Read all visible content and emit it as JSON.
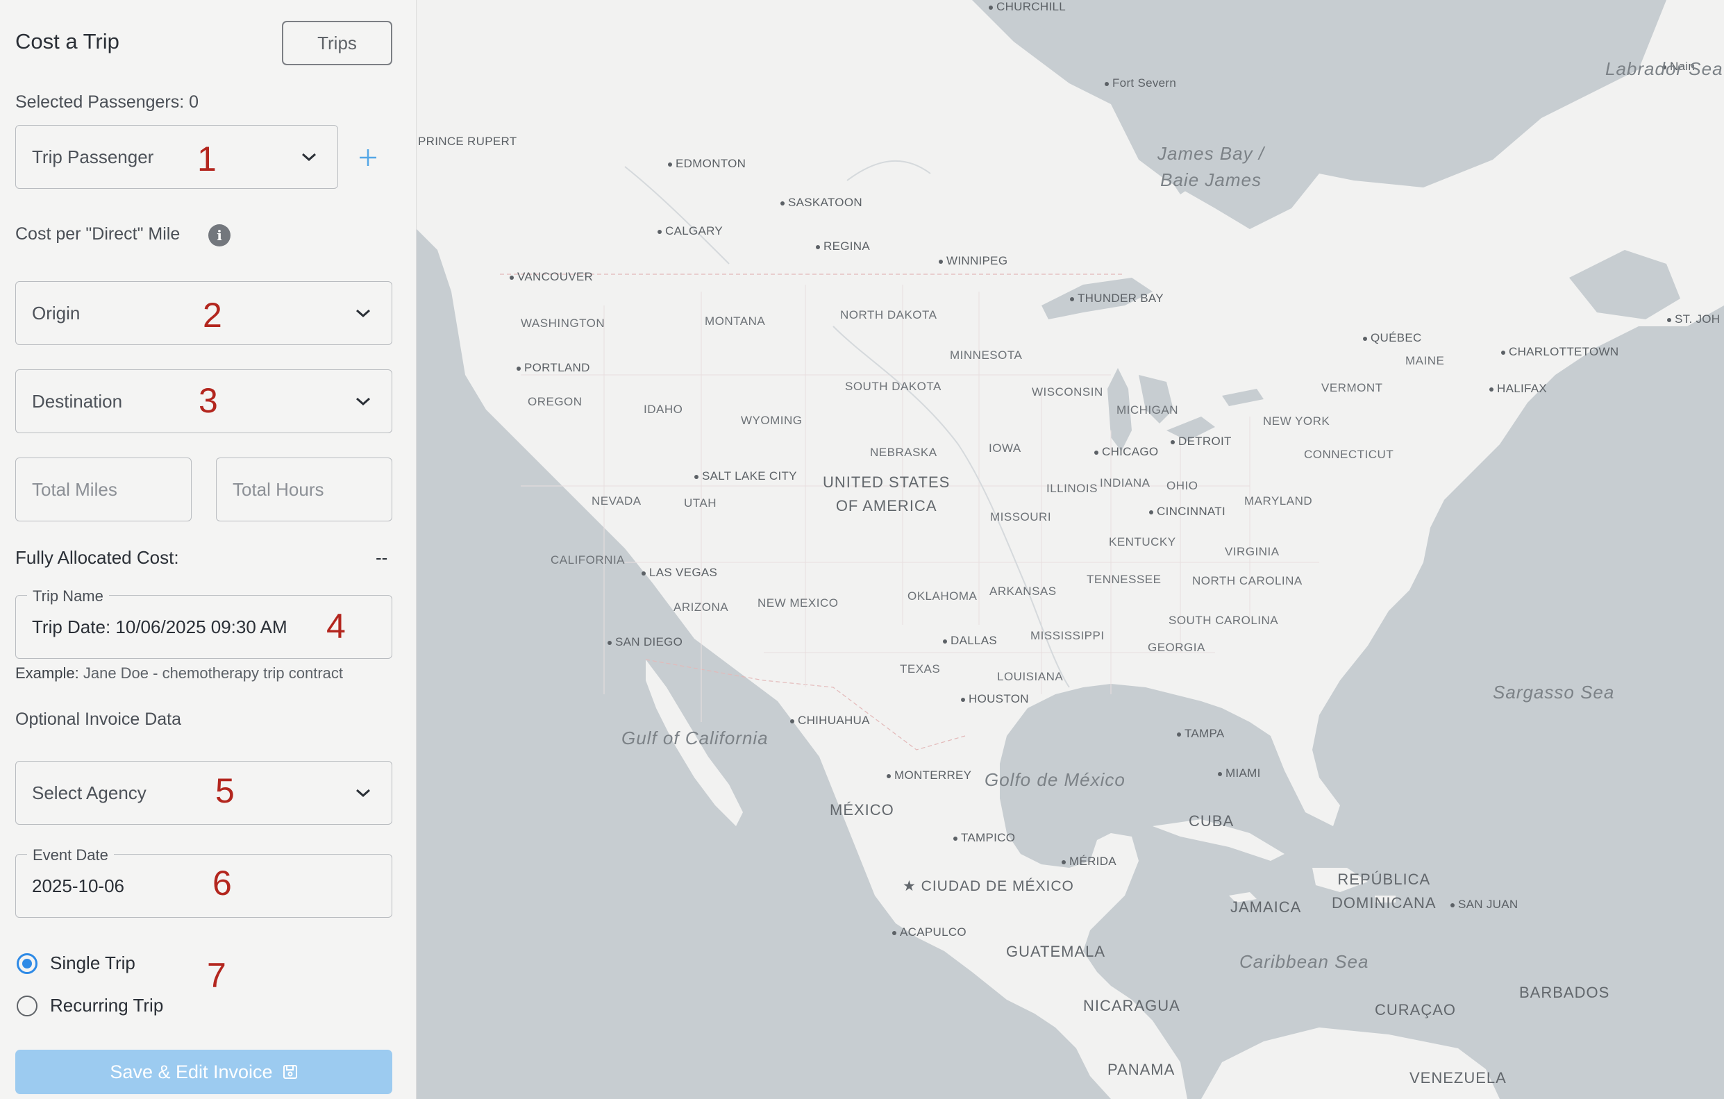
{
  "panel": {
    "title": "Cost a Trip",
    "trips_button": "Trips",
    "selected_passengers": "Selected Passengers: 0",
    "passenger_select": {
      "placeholder": "Trip Passenger",
      "marker": "1"
    },
    "add_icon": "plus-icon",
    "cost_per_mile_label": "Cost per \"Direct\" Mile",
    "info_glyph": "i",
    "origin": {
      "placeholder": "Origin",
      "marker": "2"
    },
    "destination": {
      "placeholder": "Destination",
      "marker": "3"
    },
    "total_miles": {
      "placeholder": "Total Miles"
    },
    "total_hours": {
      "placeholder": "Total Hours"
    },
    "fully_allocated_label": "Fully Allocated Cost:",
    "fully_allocated_value": "--",
    "trip_name": {
      "label": "Trip Name",
      "value": "Trip Date: 10/06/2025 09:30 AM",
      "marker": "4"
    },
    "example_prefix": "Example:",
    "example_text": "Jane Doe - chemotherapy trip contract",
    "optional_invoice": "Optional Invoice Data",
    "agency": {
      "placeholder": "Select Agency",
      "marker": "5"
    },
    "event_date": {
      "label": "Event Date",
      "value": "2025-10-06",
      "marker": "6"
    },
    "trip_type": {
      "marker": "7",
      "options": [
        {
          "label": "Single Trip",
          "selected": true
        },
        {
          "label": "Recurring Trip",
          "selected": false
        }
      ]
    },
    "save_button": "Save & Edit Invoice",
    "save_icon": "floppy-disk-icon",
    "colors": {
      "accent": "#2e8ae6",
      "save_disabled": "#9ccbf0",
      "marker": "#b3261e"
    }
  },
  "map": {
    "cities": [
      "CHURCHILL",
      "Fort Severn",
      "Nain",
      "PRINCE RUPERT",
      "EDMONTON",
      "SASKATOON",
      "CALGARY",
      "REGINA",
      "WINNIPEG",
      "VANCOUVER",
      "THUNDER BAY",
      "QUÉBEC",
      "CHARLOTTETOWN",
      "ST. JOH",
      "HALIFAX",
      "PORTLAND",
      "SALT LAKE CITY",
      "CHICAGO",
      "DETROIT",
      "CINCINNATI",
      "LAS VEGAS",
      "SAN DIEGO",
      "DALLAS",
      "HOUSTON",
      "CHIHUAHUA",
      "MONTERREY",
      "TAMPICO",
      "MÉRIDA",
      "CIUDAD DE MÉXICO",
      "ACAPULCO",
      "TAMPA",
      "MIAMI",
      "SAN JUAN"
    ],
    "regions": [
      "WASHINGTON",
      "MONTANA",
      "NORTH DAKOTA",
      "MINNESOTA",
      "SOUTH DAKOTA",
      "WISCONSIN",
      "MICHIGAN",
      "OREGON",
      "IDAHO",
      "WYOMING",
      "NEBRASKA",
      "IOWA",
      "ILLINOIS",
      "INDIANA",
      "OHIO",
      "NEVADA",
      "UTAH",
      "MISSOURI",
      "KENTUCKY",
      "CALIFORNIA",
      "ARIZONA",
      "NEW MEXICO",
      "OKLAHOMA",
      "ARKANSAS",
      "TENNESSEE",
      "MISSISSIPPI",
      "TEXAS",
      "LOUISIANA",
      "GEORGIA",
      "SOUTH CAROLINA",
      "NORTH CAROLINA",
      "VIRGINIA",
      "MARYLAND",
      "CONNECTICUT",
      "NEW YORK",
      "VERMONT",
      "MAINE"
    ],
    "countries": [
      "UNITED STATES\nOF AMERICA",
      "MÉXICO",
      "CUBA",
      "JAMAICA",
      "REPÚBLICA\nDOMINICANA",
      "GUATEMALA",
      "NICARAGUA",
      "PANAMA",
      "VENEZUELA",
      "CURAÇAO",
      "BARBADOS"
    ],
    "waters": [
      "Labrador Sea",
      "James Bay /\nBaie James",
      "Sargasso Sea",
      "Gulf of California",
      "Golfo de México",
      "Caribbean Sea"
    ]
  }
}
